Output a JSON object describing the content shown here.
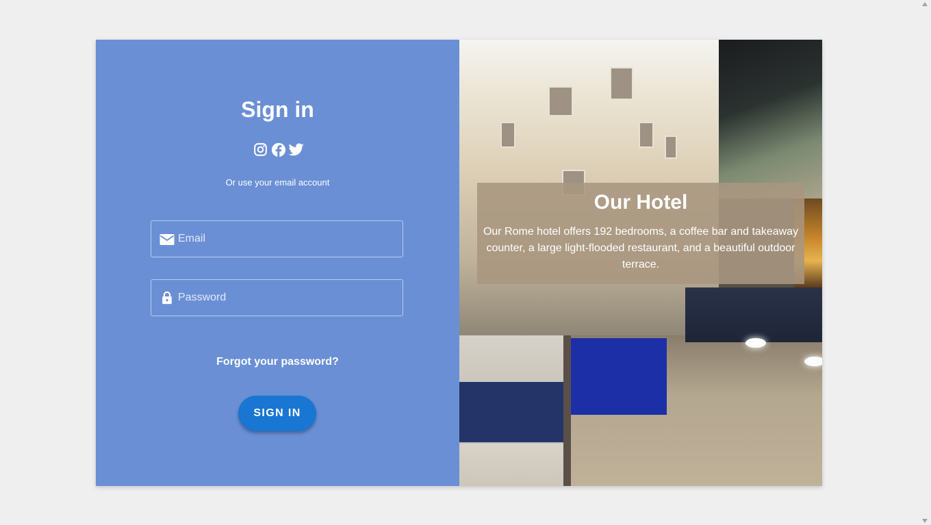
{
  "signin": {
    "title": "Sign in",
    "social_icons": [
      "instagram-icon",
      "facebook-icon",
      "twitter-icon"
    ],
    "subtitle": "Or use your email account",
    "email": {
      "placeholder": "Email",
      "value": "",
      "icon": "mail-icon"
    },
    "password": {
      "placeholder": "Password",
      "value": "",
      "icon": "lock-icon"
    },
    "forgot_label": "Forgot your password?",
    "button_label": "SIGN IN"
  },
  "hotel": {
    "title": "Our Hotel",
    "description": "Our Rome hotel offers 192 bedrooms, a coffee bar and takeaway counter, a large light-flooded restaurant, and a beautiful outdoor terrace."
  },
  "colors": {
    "left_panel_bg": "#6a8fd5",
    "button_bg": "#1976d2",
    "page_bg": "#efefef"
  }
}
